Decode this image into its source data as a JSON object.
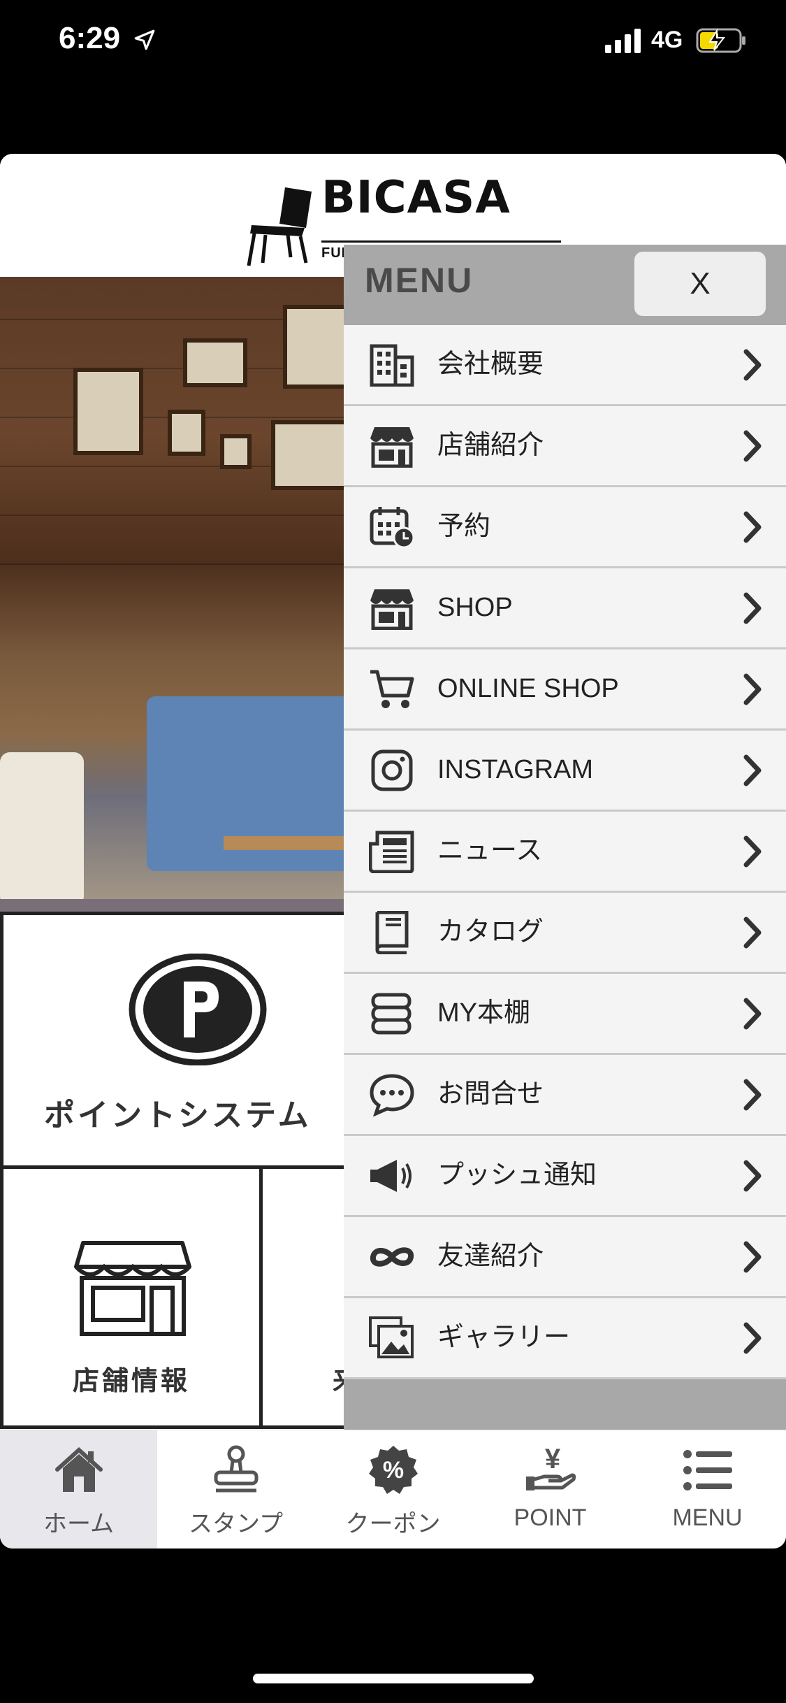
{
  "status_bar": {
    "time": "6:29",
    "network": "4G"
  },
  "header": {
    "brand": "BICASA",
    "tagline": "FURNITURE & INTERIOR GOODS"
  },
  "tiles": {
    "point_label": "ポイントシステム",
    "store_label": "店舗情報",
    "third_label_partial": "来"
  },
  "menu": {
    "title": "MENU",
    "close_label": "X",
    "items": [
      {
        "label": "会社概要",
        "icon": "building-icon"
      },
      {
        "label": "店舗紹介",
        "icon": "storefront-icon"
      },
      {
        "label": "予約",
        "icon": "calendar-clock-icon"
      },
      {
        "label": "SHOP",
        "icon": "storefront-icon"
      },
      {
        "label": "ONLINE SHOP",
        "icon": "cart-icon"
      },
      {
        "label": "INSTAGRAM",
        "icon": "instagram-icon"
      },
      {
        "label": "ニュース",
        "icon": "newspaper-icon"
      },
      {
        "label": "カタログ",
        "icon": "book-icon"
      },
      {
        "label": "MY本棚",
        "icon": "bookshelf-icon"
      },
      {
        "label": "お問合せ",
        "icon": "chat-bubble-icon"
      },
      {
        "label": "プッシュ通知",
        "icon": "megaphone-icon"
      },
      {
        "label": "友達紹介",
        "icon": "infinity-icon"
      },
      {
        "label": "ギャラリー",
        "icon": "gallery-icon"
      }
    ]
  },
  "tabbar": {
    "tabs": [
      {
        "label": "ホーム",
        "icon": "home-icon",
        "active": true
      },
      {
        "label": "スタンプ",
        "icon": "stamp-icon",
        "active": false
      },
      {
        "label": "クーポン",
        "icon": "coupon-icon",
        "active": false
      },
      {
        "label": "POINT",
        "icon": "yen-hand-icon",
        "active": false
      },
      {
        "label": "MENU",
        "icon": "list-icon",
        "active": false
      }
    ]
  },
  "colors": {
    "menu_bg": "#a8a8a8",
    "item_bg": "#f4f4f4",
    "icon": "#333333",
    "active_tab_bg": "#e8e8ec"
  }
}
